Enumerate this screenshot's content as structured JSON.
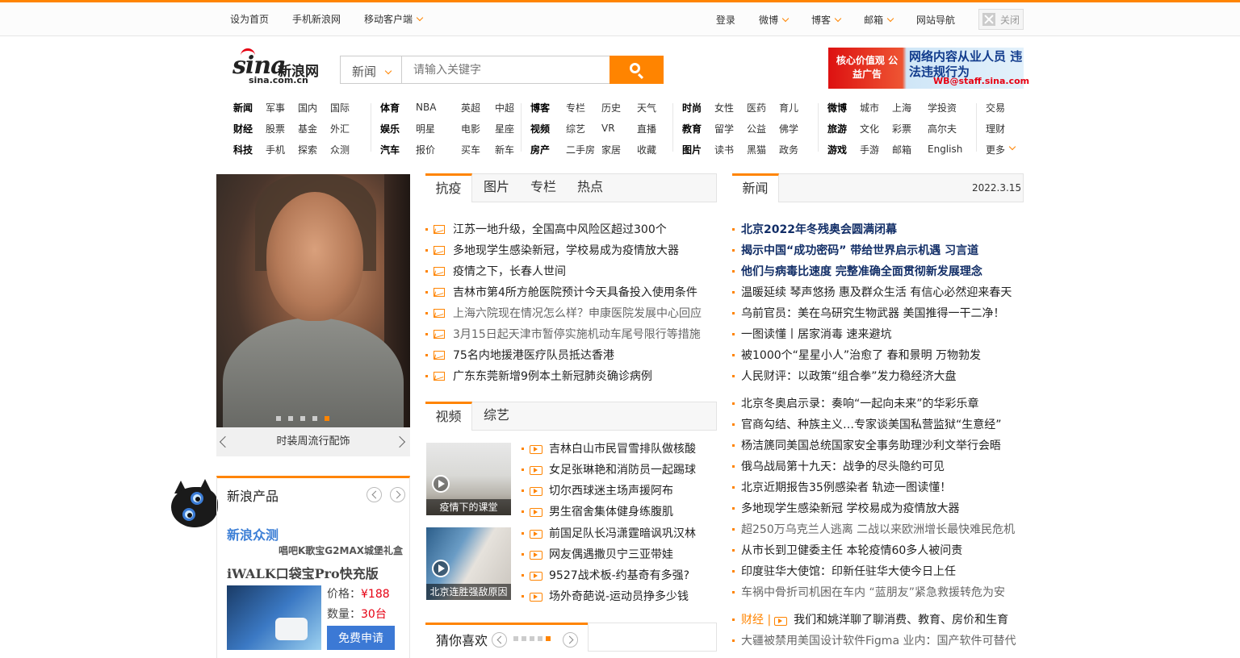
{
  "topbar": {
    "left": [
      "设为首页",
      "手机新浪网",
      "移动客户端"
    ],
    "right": [
      "登录",
      "微博",
      "博客",
      "邮箱",
      "网站导航"
    ],
    "close_label": "关闭"
  },
  "logo": {
    "brand": "sina",
    "cn": "新浪网",
    "domain": "sina.com.cn"
  },
  "search": {
    "scope": "新闻",
    "placeholder": "请输入关键字"
  },
  "banner": {
    "left_text": "核心价值观 公益广告",
    "right_text": "网络内容从业人员 违法违规行为",
    "email": "WB@staff.sina.com"
  },
  "nav": {
    "groups": [
      [
        [
          "新闻",
          "军事",
          "国内",
          "国际"
        ],
        [
          "财经",
          "股票",
          "基金",
          "外汇"
        ],
        [
          "科技",
          "手机",
          "探索",
          "众测"
        ]
      ],
      [
        [
          "体育",
          "NBA",
          "英超",
          "中超"
        ],
        [
          "娱乐",
          "明星",
          "电影",
          "星座"
        ],
        [
          "汽车",
          "报价",
          "买车",
          "新车"
        ]
      ],
      [
        [
          "博客",
          "专栏",
          "历史",
          "天气"
        ],
        [
          "视频",
          "综艺",
          "VR",
          "直播"
        ],
        [
          "房产",
          "二手房",
          "家居",
          "收藏"
        ]
      ],
      [
        [
          "时尚",
          "女性",
          "医药",
          "育儿"
        ],
        [
          "教育",
          "留学",
          "公益",
          "佛学"
        ],
        [
          "图片",
          "读书",
          "黑猫",
          "政务"
        ]
      ],
      [
        [
          "微博",
          "城市",
          "上海",
          "学投资"
        ],
        [
          "旅游",
          "文化",
          "彩票",
          "高尔夫"
        ],
        [
          "游戏",
          "手游",
          "邮箱",
          "English"
        ]
      ]
    ],
    "extra": [
      "交易",
      "理财",
      "更多"
    ]
  },
  "slideshow": {
    "caption": "时装周流行配饰",
    "active_index": 4,
    "count": 5
  },
  "product": {
    "title": "新浪产品",
    "section": "新浪众测",
    "subtitle": "唱吧K歌宝G2MAX城堡礼盒",
    "name": "iWALK口袋宝Pro快充版",
    "price_label": "价格：",
    "price": "¥188",
    "qty_label": "数量：",
    "qty": "30台",
    "apply_label": "免费申请"
  },
  "tabs1": [
    "抗疫",
    "图片",
    "专栏",
    "热点"
  ],
  "list1": [
    {
      "t": "江苏一地升级，全国高中风险区超过300个",
      "gray": false
    },
    {
      "t": "多地现学生感染新冠，学校易成为疫情放大器",
      "gray": false
    },
    {
      "t": "疫情之下，长春人世间",
      "gray": false
    },
    {
      "t": "吉林市第4所方舱医院预计今天具备投入使用条件",
      "gray": false
    },
    {
      "t": "上海六院现在情况怎么样？申康医院发展中心回应",
      "gray": true
    },
    {
      "t": "3月15日起天津市暂停实施机动车尾号限行等措施",
      "gray": true
    },
    {
      "t": "75名内地援港医疗队员抵达香港",
      "gray": false
    },
    {
      "t": "广东东莞新增9例本土新冠肺炎确诊病例",
      "gray": false
    }
  ],
  "tabs2": [
    "视频",
    "综艺"
  ],
  "video_thumbs": [
    "疫情下的课堂",
    "北京连胜强敌原因"
  ],
  "list2": [
    "吉林白山市民冒雪排队做核酸",
    "女足张琳艳和消防员一起踢球",
    "切尔西球迷主场声援阿布",
    "男生宿舍集体健身练腹肌",
    "前国足队长冯潇霆暗讽巩汉林",
    "网友偶遇撒贝宁三亚带娃",
    "9527战术板-约基奇有多强?",
    "场外奇葩说-运动员挣多少钱"
  ],
  "guess": {
    "title": "猜你喜欢",
    "active_index": 4,
    "count": 5
  },
  "news": {
    "tab": "新闻",
    "date": "2022.3.15",
    "items1": [
      {
        "t": "北京2022年冬残奥会圆满闭幕",
        "bold": true
      },
      {
        "t": "揭示中国“成功密码” 带给世界启示机遇 习言道",
        "bold": true
      },
      {
        "t": "他们与病毒比速度 完整准确全面贯彻新发展理念",
        "bold": true
      },
      {
        "t": "温暖延续 琴声悠扬 惠及群众生活 有信心必然迎来春天",
        "bold": false
      },
      {
        "t": "乌前官员：美在乌研究生物武器 美国推得一干二净！",
        "bold": false
      },
      {
        "t": "一图读懂丨居家消毒 速来避坑",
        "bold": false
      },
      {
        "t": "被1000个“星星小人”治愈了 春和景明 万物勃发",
        "bold": false
      },
      {
        "t": "人民财评：以政策“组合拳”发力稳经济大盘",
        "bold": false
      }
    ],
    "items2": [
      {
        "t": "北京冬奥启示录：奏响“一起向未来”的华彩乐章",
        "gray": false
      },
      {
        "t": "官商勾结、种族主义…专家谈美国私营监狱“生意经”",
        "gray": false
      },
      {
        "t": "杨洁篪同美国总统国家安全事务助理沙利文举行会晤",
        "gray": false
      },
      {
        "t": "俄乌战局第十九天：战争的尽头隐约可见",
        "gray": false
      },
      {
        "t": "北京近期报告35例感染者 轨迹一图读懂！",
        "gray": false
      },
      {
        "t": "多地现学生感染新冠 学校易成为疫情放大器",
        "gray": false
      },
      {
        "t": "超250万乌克兰人逃离 二战以来欧洲增长最快难民危机",
        "gray": true
      },
      {
        "t": "从市长到卫健委主任 本轮疫情60多人被问责",
        "gray": false
      },
      {
        "t": "印度驻华大使馆：印新任驻华大使今日上任",
        "gray": false
      },
      {
        "t": "车祸中骨折司机困在车内 “蓝朋友”紧急救援转危为安",
        "gray": true
      }
    ],
    "finance_tag": "财经 |",
    "finance_item": "我们和姚洋聊了聊消费、教育、房价和生育",
    "last_item": "大疆被禁用美国设计软件Figma 业内：国产软件可替代"
  }
}
